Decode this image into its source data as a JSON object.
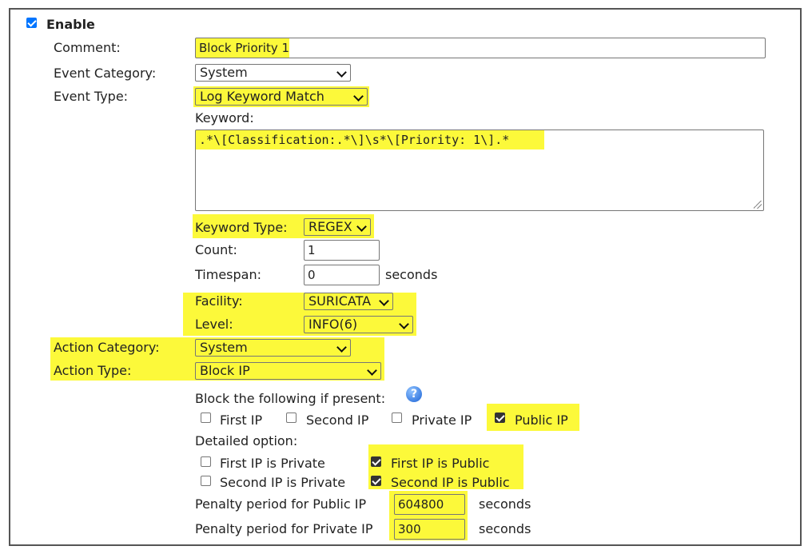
{
  "enable": {
    "label": "Enable",
    "checked": true
  },
  "comment": {
    "label": "Comment:",
    "value": "Block Priority 1"
  },
  "event_category": {
    "label": "Event Category:",
    "value": "System"
  },
  "event_type": {
    "label": "Event Type:",
    "value": "Log Keyword Match"
  },
  "keyword": {
    "label": "Keyword:",
    "value": ".*\\[Classification:.*\\]\\s*\\[Priority: 1\\].*"
  },
  "keyword_type": {
    "label": "Keyword Type:",
    "value": "REGEX"
  },
  "count": {
    "label": "Count:",
    "value": "1"
  },
  "timespan": {
    "label": "Timespan:",
    "value": "0",
    "unit": "seconds"
  },
  "facility": {
    "label": "Facility:",
    "value": "SURICATA"
  },
  "level": {
    "label": "Level:",
    "value": "INFO(6)"
  },
  "action_category": {
    "label": "Action Category:",
    "value": "System"
  },
  "action_type": {
    "label": "Action Type:",
    "value": "Block IP"
  },
  "block_if_present": {
    "label": "Block the following if present:",
    "help_icon": "question-circle-icon",
    "options": [
      {
        "label": "First IP",
        "checked": false
      },
      {
        "label": "Second IP",
        "checked": false
      },
      {
        "label": "Private IP",
        "checked": false
      },
      {
        "label": "Public IP",
        "checked": true
      }
    ]
  },
  "detailed_option": {
    "label": "Detailed option:",
    "options": [
      {
        "label": "First IP is Private",
        "checked": false
      },
      {
        "label": "First IP is Public",
        "checked": true
      },
      {
        "label": "Second IP is Private",
        "checked": false
      },
      {
        "label": "Second IP is Public",
        "checked": true
      }
    ]
  },
  "penalty_public": {
    "label": "Penalty period for Public IP",
    "value": "604800",
    "unit": "seconds"
  },
  "penalty_private": {
    "label": "Penalty period for Private IP",
    "value": "300",
    "unit": "seconds"
  },
  "colors": {
    "highlight": "#fcf93a",
    "checkbox_blue": "#0075ff",
    "border": "#767676"
  }
}
